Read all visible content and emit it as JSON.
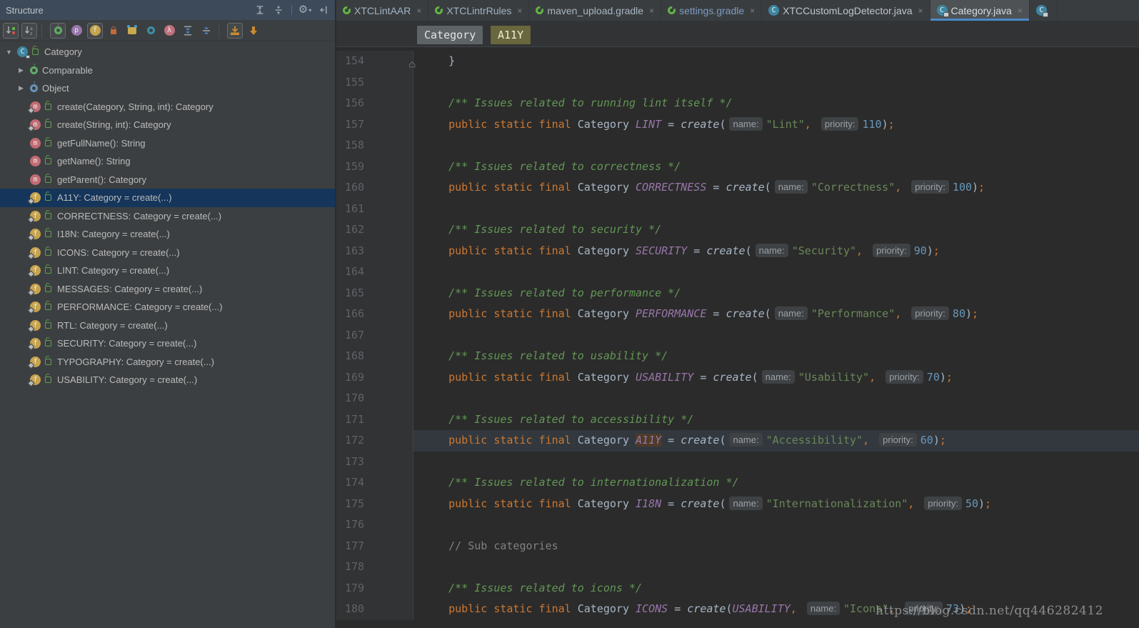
{
  "accent_colors": {
    "tab_underline": "#4A88C7",
    "selection": "#15355B",
    "keyword": "#CC7832",
    "string": "#6A8759",
    "number": "#6897BB",
    "javadoc": "#629755",
    "field": "#9876AA",
    "gradle_green": "#62B543",
    "class_icon": "#3E86A0",
    "method_icon": "#C16B72",
    "field_icon": "#C7A34D"
  },
  "ui_glyphs": {
    "close": "×",
    "arrow_down": "▼",
    "arrow_right": "▶",
    "gear": "⚙",
    "caret": "▾",
    "up": "↑"
  },
  "structure_panel": {
    "title": "Structure",
    "header_icons": [
      {
        "name": "expand-all-icon",
        "kind": "hdr-expand"
      },
      {
        "name": "collapse-all-icon",
        "kind": "hdr-collapse"
      },
      {
        "name": "separator",
        "kind": "sep"
      },
      {
        "name": "view-options-gear-icon",
        "kind": "gear"
      },
      {
        "name": "hide-tool-window-icon",
        "kind": "hide"
      }
    ],
    "toolbar": [
      {
        "name": "sort-by-visibility-button",
        "boxed": true,
        "kind": "sort-vis"
      },
      {
        "name": "sort-alphabetically-button",
        "boxed": true,
        "kind": "sort-alpha",
        "glyph": "az"
      },
      {
        "name": "separator",
        "kind": "sep"
      },
      {
        "name": "show-inherited-button",
        "boxed": true,
        "kind": "inherited",
        "glyph": "o"
      },
      {
        "name": "show-properties-button",
        "boxed": false,
        "kind": "circle",
        "glyph": "p",
        "bg": "#9876AA"
      },
      {
        "name": "show-fields-button",
        "boxed": true,
        "kind": "circle",
        "glyph": "f",
        "bg": "#C7A34D"
      },
      {
        "name": "show-non-public-button",
        "boxed": false,
        "kind": "lock"
      },
      {
        "name": "show-anonymous-classes-button",
        "boxed": false,
        "kind": "anon"
      },
      {
        "name": "show-scope-button",
        "boxed": false,
        "kind": "donut"
      },
      {
        "name": "show-lambdas-button",
        "boxed": false,
        "kind": "circle",
        "glyph": "λ",
        "bg": "#C2707F"
      },
      {
        "name": "expand-rows-button",
        "boxed": false,
        "kind": "expand"
      },
      {
        "name": "collapse-rows-button",
        "boxed": false,
        "kind": "collapse"
      },
      {
        "name": "separator",
        "kind": "sep"
      },
      {
        "name": "scroll-to-source-button",
        "boxed": true,
        "kind": "tray"
      },
      {
        "name": "autoscroll-from-source-button",
        "boxed": false,
        "kind": "tray2"
      }
    ],
    "tree": [
      {
        "label": "Category",
        "depth": 0,
        "arrow": "down",
        "icon": "class",
        "lock": true,
        "vis": true
      },
      {
        "label": "Comparable",
        "depth": 1,
        "arrow": "right",
        "icon": "iface"
      },
      {
        "label": "Object",
        "depth": 1,
        "arrow": "right",
        "icon": "obj"
      },
      {
        "label": "create(Category, String, int): Category",
        "depth": 1,
        "icon": "method",
        "static": true,
        "vis": true
      },
      {
        "label": "create(String, int): Category",
        "depth": 1,
        "icon": "method",
        "static": true,
        "vis": true
      },
      {
        "label": "getFullName(): String",
        "depth": 1,
        "icon": "method",
        "vis": true
      },
      {
        "label": "getName(): String",
        "depth": 1,
        "icon": "method",
        "vis": true
      },
      {
        "label": "getParent(): Category",
        "depth": 1,
        "icon": "method",
        "vis": true
      },
      {
        "label": "A11Y: Category = create(...)",
        "depth": 1,
        "icon": "field",
        "static": true,
        "vis": true,
        "selected": true
      },
      {
        "label": "CORRECTNESS: Category = create(...)",
        "depth": 1,
        "icon": "field",
        "static": true,
        "vis": true
      },
      {
        "label": "I18N: Category = create(...)",
        "depth": 1,
        "icon": "field",
        "static": true,
        "vis": true
      },
      {
        "label": "ICONS: Category = create(...)",
        "depth": 1,
        "icon": "field",
        "static": true,
        "vis": true
      },
      {
        "label": "LINT: Category = create(...)",
        "depth": 1,
        "icon": "field",
        "static": true,
        "vis": true
      },
      {
        "label": "MESSAGES: Category = create(...)",
        "depth": 1,
        "icon": "field",
        "static": true,
        "vis": true
      },
      {
        "label": "PERFORMANCE: Category = create(...)",
        "depth": 1,
        "icon": "field",
        "static": true,
        "vis": true
      },
      {
        "label": "RTL: Category = create(...)",
        "depth": 1,
        "icon": "field",
        "static": true,
        "vis": true
      },
      {
        "label": "SECURITY: Category = create(...)",
        "depth": 1,
        "icon": "field",
        "static": true,
        "vis": true
      },
      {
        "label": "TYPOGRAPHY: Category = create(...)",
        "depth": 1,
        "icon": "field",
        "static": true,
        "vis": true
      },
      {
        "label": "USABILITY: Category = create(...)",
        "depth": 1,
        "icon": "field",
        "static": true,
        "vis": true
      }
    ]
  },
  "tabs": [
    {
      "label": "XTCLintAAR",
      "icon": "gradle",
      "close": true,
      "label_color": "#9FB3C6"
    },
    {
      "label": "XTCLintrRules",
      "icon": "gradle",
      "close": true,
      "label_color": "#9FB3C6"
    },
    {
      "label": "maven_upload.gradle",
      "icon": "gradle",
      "close": true,
      "label_color": "#A8B6C2"
    },
    {
      "label": "settings.gradle",
      "icon": "gradle",
      "close": true,
      "label_color": "#7C9BC4"
    },
    {
      "label": "XTCCustomLogDetector.java",
      "icon": "class",
      "close": true,
      "label_color": "#BDC6CE"
    },
    {
      "label": "Category.java",
      "icon": "class-lock",
      "close": true,
      "active": true
    },
    {
      "label": "",
      "icon": "class-lock",
      "partial": true
    }
  ],
  "breadcrumb_chips": [
    {
      "label": "Category",
      "style": "gray"
    },
    {
      "label": "A11Y",
      "style": "olive"
    }
  ],
  "editor": {
    "current_line": 172,
    "lines": [
      {
        "n": 154,
        "fold": true,
        "tokens": [
          [
            "pln",
            "    }"
          ]
        ]
      },
      {
        "n": 155,
        "tokens": []
      },
      {
        "n": 156,
        "tokens": [
          [
            "pln",
            "    "
          ],
          [
            "doc",
            "/** Issues related to running lint itself */"
          ]
        ]
      },
      {
        "n": 157,
        "tokens": [
          [
            "pln",
            "    "
          ],
          [
            "kw",
            "public static final"
          ],
          [
            "pln",
            " Category "
          ],
          [
            "fld",
            "LINT"
          ],
          [
            "pln",
            " = "
          ],
          [
            "mth",
            "create"
          ],
          [
            "pln",
            "("
          ],
          [
            "hint",
            "name:"
          ],
          [
            "str",
            "\"Lint\""
          ],
          [
            "pun",
            ","
          ],
          [
            "pln",
            " "
          ],
          [
            "hint",
            "priority:"
          ],
          [
            "num",
            "110"
          ],
          [
            "pln",
            ")"
          ],
          [
            "pun",
            ";"
          ]
        ]
      },
      {
        "n": 158,
        "tokens": []
      },
      {
        "n": 159,
        "tokens": [
          [
            "pln",
            "    "
          ],
          [
            "doc",
            "/** Issues related to correctness */"
          ]
        ]
      },
      {
        "n": 160,
        "tokens": [
          [
            "pln",
            "    "
          ],
          [
            "kw",
            "public static final"
          ],
          [
            "pln",
            " Category "
          ],
          [
            "fld",
            "CORRECTNESS"
          ],
          [
            "pln",
            " = "
          ],
          [
            "mth",
            "create"
          ],
          [
            "pln",
            "("
          ],
          [
            "hint",
            "name:"
          ],
          [
            "str",
            "\"Correctness\""
          ],
          [
            "pun",
            ","
          ],
          [
            "pln",
            " "
          ],
          [
            "hint",
            "priority:"
          ],
          [
            "num",
            "100"
          ],
          [
            "pln",
            ")"
          ],
          [
            "pun",
            ";"
          ]
        ]
      },
      {
        "n": 161,
        "tokens": []
      },
      {
        "n": 162,
        "tokens": [
          [
            "pln",
            "    "
          ],
          [
            "doc",
            "/** Issues related to security */"
          ]
        ]
      },
      {
        "n": 163,
        "tokens": [
          [
            "pln",
            "    "
          ],
          [
            "kw",
            "public static final"
          ],
          [
            "pln",
            " Category "
          ],
          [
            "fld",
            "SECURITY"
          ],
          [
            "pln",
            " = "
          ],
          [
            "mth",
            "create"
          ],
          [
            "pln",
            "("
          ],
          [
            "hint",
            "name:"
          ],
          [
            "str",
            "\"Security\""
          ],
          [
            "pun",
            ","
          ],
          [
            "pln",
            " "
          ],
          [
            "hint",
            "priority:"
          ],
          [
            "num",
            "90"
          ],
          [
            "pln",
            ")"
          ],
          [
            "pun",
            ";"
          ]
        ]
      },
      {
        "n": 164,
        "tokens": []
      },
      {
        "n": 165,
        "tokens": [
          [
            "pln",
            "    "
          ],
          [
            "doc",
            "/** Issues related to performance */"
          ]
        ]
      },
      {
        "n": 166,
        "tokens": [
          [
            "pln",
            "    "
          ],
          [
            "kw",
            "public static final"
          ],
          [
            "pln",
            " Category "
          ],
          [
            "fld",
            "PERFORMANCE"
          ],
          [
            "pln",
            " = "
          ],
          [
            "mth",
            "create"
          ],
          [
            "pln",
            "("
          ],
          [
            "hint",
            "name:"
          ],
          [
            "str",
            "\"Performance\""
          ],
          [
            "pun",
            ","
          ],
          [
            "pln",
            " "
          ],
          [
            "hint",
            "priority:"
          ],
          [
            "num",
            "80"
          ],
          [
            "pln",
            ")"
          ],
          [
            "pun",
            ";"
          ]
        ]
      },
      {
        "n": 167,
        "tokens": []
      },
      {
        "n": 168,
        "tokens": [
          [
            "pln",
            "    "
          ],
          [
            "doc",
            "/** Issues related to usability */"
          ]
        ]
      },
      {
        "n": 169,
        "tokens": [
          [
            "pln",
            "    "
          ],
          [
            "kw",
            "public static final"
          ],
          [
            "pln",
            " Category "
          ],
          [
            "fld",
            "USABILITY"
          ],
          [
            "pln",
            " = "
          ],
          [
            "mth",
            "create"
          ],
          [
            "pln",
            "("
          ],
          [
            "hint",
            "name:"
          ],
          [
            "str",
            "\"Usability\""
          ],
          [
            "pun",
            ","
          ],
          [
            "pln",
            " "
          ],
          [
            "hint",
            "priority:"
          ],
          [
            "num",
            "70"
          ],
          [
            "pln",
            ")"
          ],
          [
            "pun",
            ";"
          ]
        ]
      },
      {
        "n": 170,
        "tokens": []
      },
      {
        "n": 171,
        "tokens": [
          [
            "pln",
            "    "
          ],
          [
            "doc",
            "/** Issues related to accessibility */"
          ]
        ]
      },
      {
        "n": 172,
        "tokens": [
          [
            "pln",
            "    "
          ],
          [
            "kw",
            "public static final"
          ],
          [
            "pln",
            " Category "
          ],
          [
            "fldhl",
            "A11Y"
          ],
          [
            "pln",
            " = "
          ],
          [
            "mth",
            "create"
          ],
          [
            "pln",
            "("
          ],
          [
            "hint",
            "name:"
          ],
          [
            "str",
            "\"Accessibility\""
          ],
          [
            "pun",
            ","
          ],
          [
            "pln",
            " "
          ],
          [
            "hint",
            "priority:"
          ],
          [
            "num",
            "60"
          ],
          [
            "pln",
            ")"
          ],
          [
            "pun",
            ";"
          ]
        ]
      },
      {
        "n": 173,
        "tokens": []
      },
      {
        "n": 174,
        "tokens": [
          [
            "pln",
            "    "
          ],
          [
            "doc",
            "/** Issues related to internationalization */"
          ]
        ]
      },
      {
        "n": 175,
        "tokens": [
          [
            "pln",
            "    "
          ],
          [
            "kw",
            "public static final"
          ],
          [
            "pln",
            " Category "
          ],
          [
            "fld",
            "I18N"
          ],
          [
            "pln",
            " = "
          ],
          [
            "mth",
            "create"
          ],
          [
            "pln",
            "("
          ],
          [
            "hint",
            "name:"
          ],
          [
            "str",
            "\"Internationalization\""
          ],
          [
            "pun",
            ","
          ],
          [
            "pln",
            " "
          ],
          [
            "hint",
            "priority:"
          ],
          [
            "num",
            "50"
          ],
          [
            "pln",
            ")"
          ],
          [
            "pun",
            ";"
          ]
        ]
      },
      {
        "n": 176,
        "tokens": []
      },
      {
        "n": 177,
        "tokens": [
          [
            "pln",
            "    "
          ],
          [
            "cmt",
            "// Sub categories"
          ]
        ]
      },
      {
        "n": 178,
        "tokens": []
      },
      {
        "n": 179,
        "tokens": [
          [
            "pln",
            "    "
          ],
          [
            "doc",
            "/** Issues related to icons */"
          ]
        ]
      },
      {
        "n": 180,
        "tokens": [
          [
            "pln",
            "    "
          ],
          [
            "kw",
            "public static final"
          ],
          [
            "pln",
            " Category "
          ],
          [
            "fld",
            "ICONS"
          ],
          [
            "pln",
            " = "
          ],
          [
            "mth",
            "create"
          ],
          [
            "pln",
            "("
          ],
          [
            "fld",
            "USABILITY"
          ],
          [
            "pun",
            ","
          ],
          [
            "pln",
            " "
          ],
          [
            "hint",
            "name:"
          ],
          [
            "str",
            "\"Icons\""
          ],
          [
            "pun",
            ","
          ],
          [
            "pln",
            " "
          ],
          [
            "hint",
            "priority:"
          ],
          [
            "num",
            "73"
          ],
          [
            "pln",
            ")"
          ],
          [
            "pun",
            ";"
          ]
        ]
      }
    ]
  },
  "watermark": "https://blog.csdn.net/qq446282412"
}
